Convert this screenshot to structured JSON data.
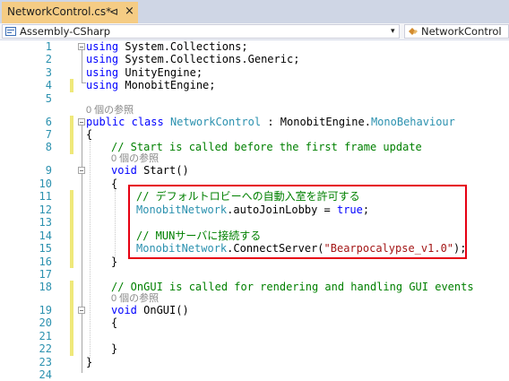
{
  "tab": {
    "title": "NetworkControl.cs*",
    "pin": "⊲",
    "close": "×"
  },
  "nav": {
    "project": "Assembly-CSharp",
    "cls": "NetworkControl",
    "arrow": "▾"
  },
  "ref_note": "0 個の参照",
  "line_numbers": [
    "1",
    "2",
    "3",
    "4",
    "5",
    "6",
    "7",
    "8",
    "9",
    "10",
    "11",
    "12",
    "13",
    "14",
    "15",
    "16",
    "17",
    "18",
    "19",
    "20",
    "21",
    "22",
    "23",
    "24"
  ],
  "code": {
    "l1": {
      "kw": "using",
      "rest": " System.Collections;"
    },
    "l2": {
      "kw": "using",
      "rest": " System.Collections.Generic;"
    },
    "l3": {
      "kw": "using",
      "rest": " UnityEngine;"
    },
    "l4": {
      "kw": "using",
      "rest": " MonobitEngine;"
    },
    "l6": {
      "kw1": "public",
      "kw2": "class",
      "cls": "NetworkControl",
      "sep": " : ",
      "ns": "MonobitEngine.",
      "base": "MonoBehaviour"
    },
    "l7": "{",
    "l8": "// Start is called before the first frame update",
    "l9": {
      "kw": "void",
      "name": " Start()"
    },
    "l10": "{",
    "l11": "// デフォルトロビーへの自動入室を許可する",
    "l12": {
      "ty": "MonobitNetwork",
      "mid": ".autoJoinLobby = ",
      "kw": "true",
      "end": ";"
    },
    "l14": "// MUNサーバに接続する",
    "l15": {
      "ty": "MonobitNetwork",
      "mid": ".ConnectServer(",
      "str": "\"Bearpocalypse_v1.0\"",
      "end": ");"
    },
    "l16": "}",
    "l18": "// OnGUI is called for rendering and handling GUI events",
    "l19": {
      "kw": "void",
      "name": " OnGUI()"
    },
    "l20": "{",
    "l22": "}",
    "l23": "}"
  }
}
